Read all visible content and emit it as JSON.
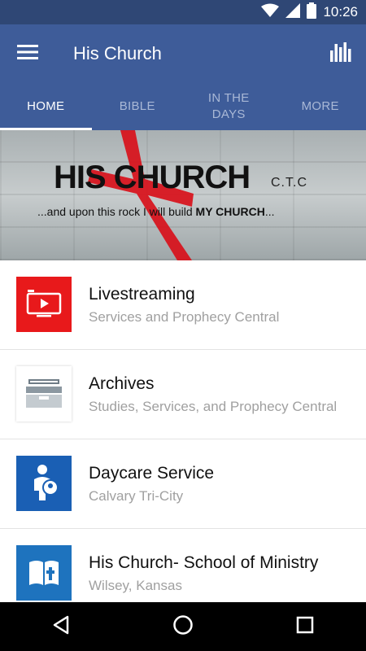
{
  "status_bar": {
    "time": "10:26",
    "icons": [
      "wifi-icon",
      "cell-signal-icon",
      "battery-icon"
    ]
  },
  "app_bar": {
    "title": "His Church",
    "left_icon": "hamburger-menu-icon",
    "right_icon": "bar-chart-icon"
  },
  "tabs": [
    {
      "label": "HOME",
      "active": true
    },
    {
      "label": "BIBLE",
      "active": false
    },
    {
      "label": "IN THE\nDAYS",
      "active": false
    },
    {
      "label": "MORE",
      "active": false
    }
  ],
  "banner": {
    "title": "HIS CHURCH",
    "title_suffix": "C.T.C",
    "tagline_start": "...and upon this rock I will build ",
    "tagline_bold": "MY CHURCH",
    "tagline_end": "..."
  },
  "items": [
    {
      "title": "Livestreaming",
      "subtitle": "Services and Prophecy Central",
      "icon": "live-tv-icon",
      "icon_bg": "#e8191b"
    },
    {
      "title": "Archives",
      "subtitle": "Studies, Services, and Prophecy Central",
      "icon": "archive-box-icon",
      "icon_bg": "#ffffff"
    },
    {
      "title": "Daycare Service",
      "subtitle": "Calvary Tri-City",
      "icon": "mother-child-icon",
      "icon_bg": "#1a5fb4"
    },
    {
      "title": "His Church- School of Ministry",
      "subtitle": "Wilsey, Kansas",
      "icon": "bible-cross-icon",
      "icon_bg": "#1e73be"
    }
  ],
  "colors": {
    "status_bar": "#2f4775",
    "app_bar": "#3e5c99",
    "cross_red": "#d8101a"
  },
  "nav_bar": {
    "icons": [
      "back-icon",
      "home-circle-icon",
      "recents-square-icon"
    ]
  }
}
